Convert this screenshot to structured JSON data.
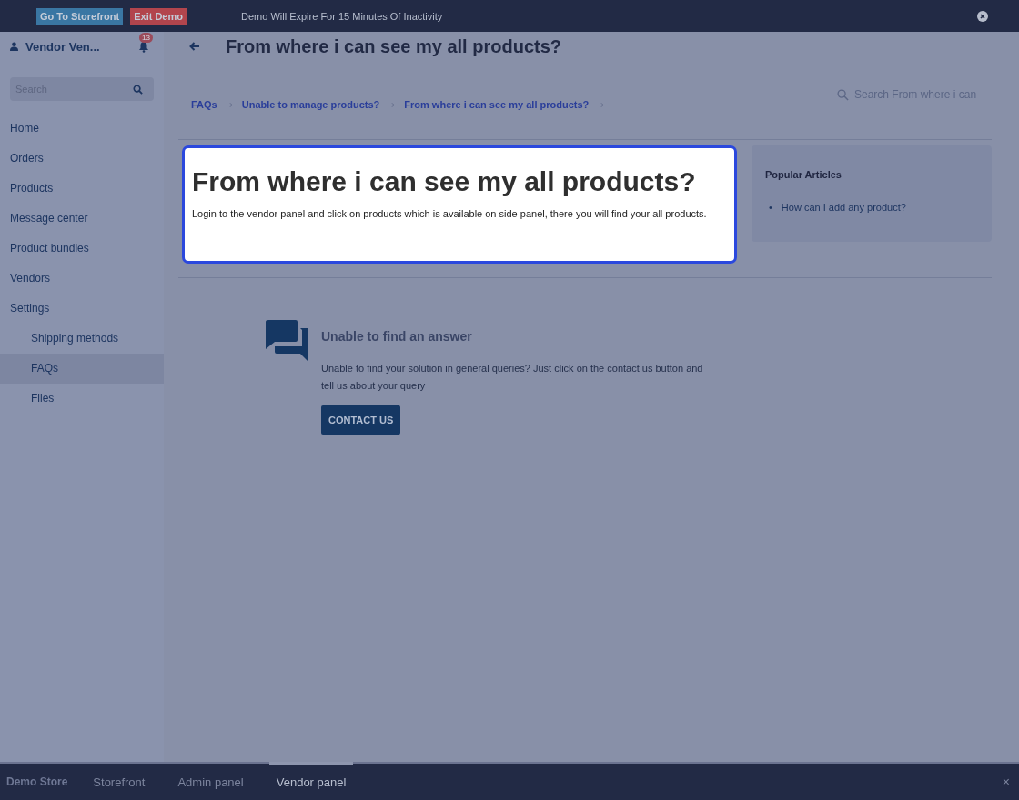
{
  "demo_bar": {
    "buttons": [
      {
        "label": "Go To Storefront",
        "kind": "storefront"
      },
      {
        "label": "Exit Demo",
        "kind": "exit"
      }
    ],
    "message": "Demo Will Expire For 15 Minutes Of Inactivity"
  },
  "sidebar": {
    "vendor_name": "Vendor Ven...",
    "notification_count": "13",
    "search": {
      "placeholder": "Search"
    },
    "items": [
      {
        "label": "Home",
        "selected": false
      },
      {
        "label": "Orders",
        "selected": false
      },
      {
        "label": "Products",
        "selected": false
      },
      {
        "label": "Message center",
        "selected": false
      },
      {
        "label": "Product bundles",
        "selected": false
      },
      {
        "label": "Vendors",
        "selected": false
      },
      {
        "label": "Settings",
        "selected": false,
        "children": [
          {
            "label": "Shipping methods",
            "selected": false
          },
          {
            "label": "FAQs",
            "selected": true
          },
          {
            "label": "Files",
            "selected": false
          }
        ]
      }
    ]
  },
  "page": {
    "title": "From where i can see my all products?",
    "breadcrumbs": [
      "FAQs",
      "Unable to manage products?",
      "From where i can see my all products?"
    ],
    "search": {
      "placeholder": "Search From where i can"
    }
  },
  "article": {
    "title": "From where i can see my all products?",
    "body": "Login to the vendor panel and click on products which is available on side panel, there you will find your all products."
  },
  "popular_articles": {
    "title": "Popular Articles",
    "bullet": "•",
    "items": [
      "How can I add any product?"
    ]
  },
  "help": {
    "title": "Unable to find an answer",
    "text": "Unable to find your solution in general queries? Just click on the contact us button and tell us about your query",
    "button": "CONTACT US"
  },
  "bottom_bar": {
    "brand": "Demo Store",
    "tabs": [
      {
        "label": "Storefront",
        "selected": false
      },
      {
        "label": "Admin panel",
        "selected": false
      },
      {
        "label": "Vendor panel",
        "selected": true
      }
    ],
    "close": "×"
  }
}
